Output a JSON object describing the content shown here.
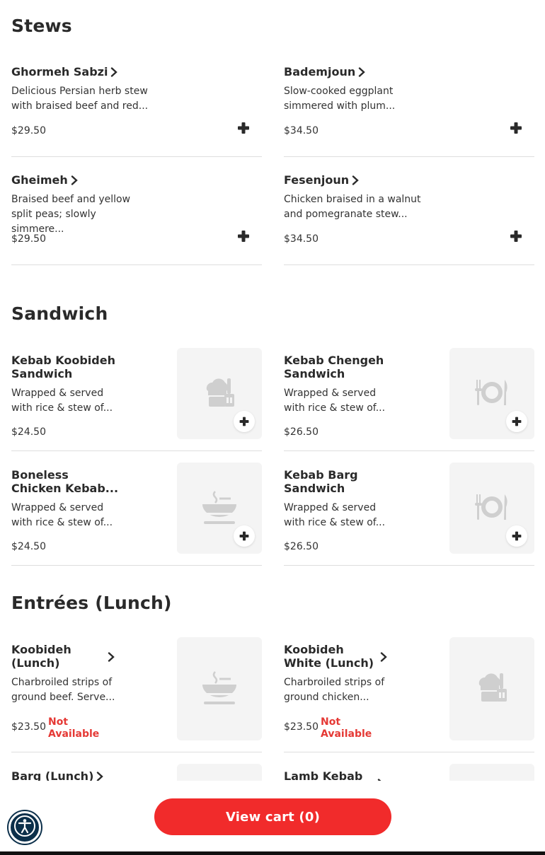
{
  "sections": {
    "stews": "Stews",
    "sandwich": "Sandwich",
    "entrees": "Entrées (Lunch)"
  },
  "stews": [
    {
      "name": "Ghormeh Sabzi",
      "desc1": "Delicious Persian herb stew",
      "desc2": "with braised beef and red...",
      "price": "$29.50"
    },
    {
      "name": "Bademjoun",
      "desc1": "Slow-cooked eggplant",
      "desc2": "simmered with plum...",
      "price": "$34.50"
    },
    {
      "name": "Gheimeh",
      "desc1": "Braised beef and yellow",
      "desc2": "split peas; slowly simmere...",
      "price": "$29.50"
    },
    {
      "name": "Fesenjoun",
      "desc1": "Chicken braised in a walnut",
      "desc2": "and pomegranate stew...",
      "price": "$34.50"
    }
  ],
  "sandwiches": [
    {
      "name1": "Kebab Koobideh",
      "name2": "Sandwich",
      "desc1": "Wrapped & served",
      "desc2": "with rice & stew of...",
      "price": "$24.50",
      "icon": "chef-icon"
    },
    {
      "name1": "Kebab Chengeh",
      "name2": "Sandwich",
      "desc1": "Wrapped & served",
      "desc2": "with rice & stew of...",
      "price": "$26.50",
      "icon": "plate-icon"
    },
    {
      "name1": "Boneless",
      "name2": "Chicken Kebab...",
      "desc1": "Wrapped & served",
      "desc2": "with rice & stew of...",
      "price": "$24.50",
      "icon": "bowl-icon"
    },
    {
      "name1": "Kebab Barg",
      "name2": "Sandwich",
      "desc1": "Wrapped & served",
      "desc2": "with rice & stew of...",
      "price": "$26.50",
      "icon": "plate-icon"
    }
  ],
  "entrees": [
    {
      "name1": "Koobideh",
      "name2": "(Lunch)",
      "desc1": "Charbroiled strips of",
      "desc2": "ground beef. Serve...",
      "price": "$23.50",
      "status1": "Not",
      "status2": "Available",
      "icon": "bowl-icon"
    },
    {
      "name1": "Koobideh",
      "name2": "White (Lunch)",
      "desc1": "Charbroiled strips of",
      "desc2": "ground chicken...",
      "price": "$23.50",
      "status1": "Not",
      "status2": "Available",
      "icon": "chef-icon"
    },
    {
      "name1": "Barg (Lunch)"
    },
    {
      "name1": "Lamb Kebab"
    }
  ],
  "cart": {
    "label": "View cart (0)"
  },
  "colors": {
    "accent": "#f12b2b",
    "status_red": "#e53935",
    "a11y_bg": "#0b2f4a"
  },
  "icons": {
    "accessibility": "accessibility-icon",
    "add": "plus-icon",
    "chevron": "chevron-right-icon"
  }
}
